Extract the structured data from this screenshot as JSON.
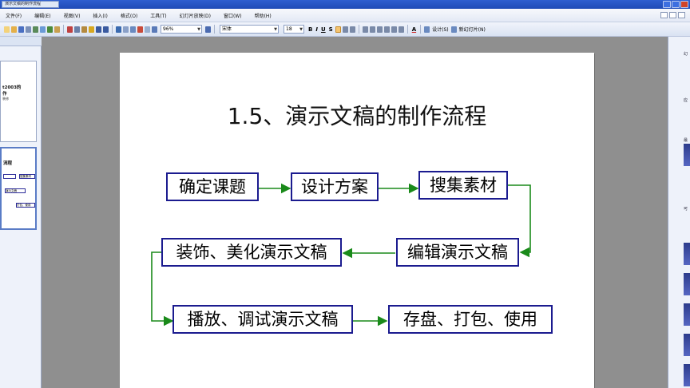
{
  "window": {
    "title_tab": "演示文稿的制作流程"
  },
  "menu": {
    "items": [
      "文件(F)",
      "编辑(E)",
      "视图(V)",
      "插入(I)",
      "格式(O)",
      "工具(T)",
      "幻灯片放映(D)",
      "窗口(W)",
      "帮助(H)"
    ]
  },
  "toolbar": {
    "zoom": "96%",
    "font": "宋体",
    "font_size": "18",
    "bold": "B",
    "italic": "I",
    "underline": "U",
    "shadow": "S",
    "font_color": "A",
    "design_label": "设计(S)",
    "new_slide_label": "新幻灯片(N)"
  },
  "left_pane": {
    "thumb1_title": "t2003的",
    "thumb1_line2": "作",
    "thumb1_small": "装修",
    "thumb2_title": "流程",
    "thumb2_box1": "搜集素材",
    "thumb2_box2": "演示文稿",
    "thumb2_box3": "打包、使用"
  },
  "slide": {
    "title": "1.5、演示文稿的制作流程",
    "boxes": {
      "b1": "确定课题",
      "b2": "设计方案",
      "b3": "搜集素材",
      "b4": "编辑演示文稿",
      "b5": "装饰、美化演示文稿",
      "b6": "播放、调试演示文稿",
      "b7": "存盘、打包、使用"
    },
    "arrow_color": "#1a8a1a",
    "box_border_color": "#1b1b8f"
  },
  "right_pane": {
    "labels": [
      "幻",
      "应",
      "最",
      "可"
    ]
  }
}
